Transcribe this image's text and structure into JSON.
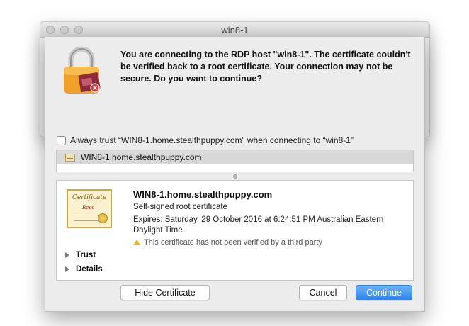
{
  "window": {
    "title": "win8-1"
  },
  "dialog": {
    "message": "You are connecting to the RDP host \"win8-1\". The certificate couldn't be verified back to a root certificate. Your connection may not be secure. Do you want to continue?",
    "always_trust_label": "Always trust “WIN8-1.home.stealthpuppy.com” when connecting to “win8-1”",
    "always_trust_checked": false,
    "cert_list": [
      {
        "label": "WIN8-1.home.stealthpuppy.com",
        "selected": true
      }
    ],
    "cert_details": {
      "image_title": "Certificate",
      "image_subtitle": "Root",
      "name": "WIN8-1.home.stealthpuppy.com",
      "type": "Self-signed root certificate",
      "expires": "Expires: Saturday, 29 October 2016 at 6:24:51 PM Australian Eastern Daylight Time",
      "warning": "This certificate has not been verified by a third party",
      "sections": [
        "Trust",
        "Details"
      ]
    },
    "buttons": {
      "hide_certificate": "Hide Certificate",
      "cancel": "Cancel",
      "continue": "Continue"
    }
  },
  "icons": {
    "lock": "padlock-certificate-icon",
    "cert_row": "certificate-small-icon",
    "warning": "warning-triangle-icon",
    "disclosure": "disclosure-triangle-icon"
  },
  "colors": {
    "accent": "#2a84f0",
    "warning": "#e7b43a",
    "lock_body": "#f0a12b"
  }
}
